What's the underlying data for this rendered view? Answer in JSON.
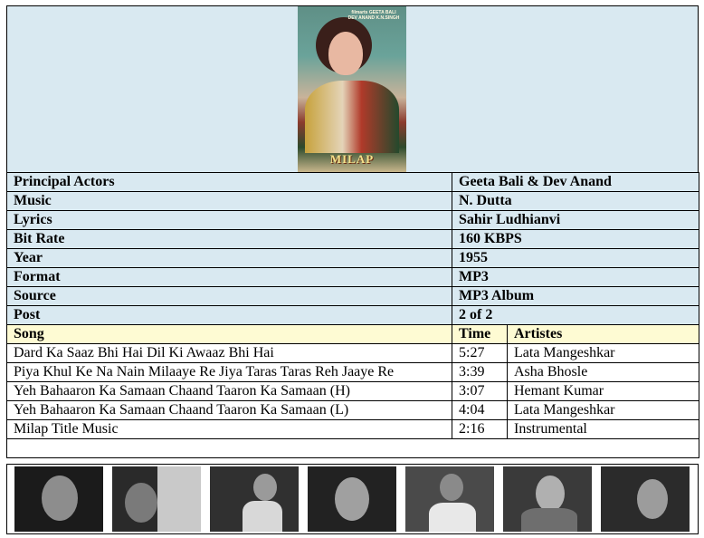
{
  "poster": {
    "title": "MILAP",
    "credits": "filmarts GEETA BALI DEV ANAND K.N.SINGH"
  },
  "details": [
    {
      "label": "Principal Actors",
      "value": "Geeta Bali & Dev Anand"
    },
    {
      "label": "Music",
      "value": "N. Dutta"
    },
    {
      "label": "Lyrics",
      "value": "Sahir Ludhianvi"
    },
    {
      "label": "Bit Rate",
      "value": "160 KBPS"
    },
    {
      "label": "Year",
      "value": "1955"
    },
    {
      "label": "Format",
      "value": "MP3"
    },
    {
      "label": "Source",
      "value": "MP3 Album"
    },
    {
      "label": "Post",
      "value": "2 of 2"
    }
  ],
  "songs_header": {
    "song": "Song",
    "time": "Time",
    "artistes": "Artistes"
  },
  "songs": [
    {
      "song": "Dard Ka Saaz Bhi Hai Dil Ki Awaaz Bhi Hai",
      "time": "5:27",
      "artiste": "Lata Mangeshkar"
    },
    {
      "song": "Piya Khul Ke Na Nain Milaaye Re Jiya Taras Taras Reh Jaaye Re",
      "time": "3:39",
      "artiste": "Asha Bhosle"
    },
    {
      "song": "Yeh Bahaaron Ka Samaan Chaand Taaron Ka Samaan (H)",
      "time": "3:07",
      "artiste": "Hemant Kumar"
    },
    {
      "song": "Yeh Bahaaron Ka Samaan Chaand Taaron Ka Samaan (L)",
      "time": "4:04",
      "artiste": "Lata Mangeshkar"
    },
    {
      "song": "Milap Title Music",
      "time": "2:16",
      "artiste": "Instrumental"
    }
  ],
  "colors": {
    "meta_bg": "#d9e9f1",
    "header_bg": "#fefbd3",
    "border": "#000000"
  }
}
